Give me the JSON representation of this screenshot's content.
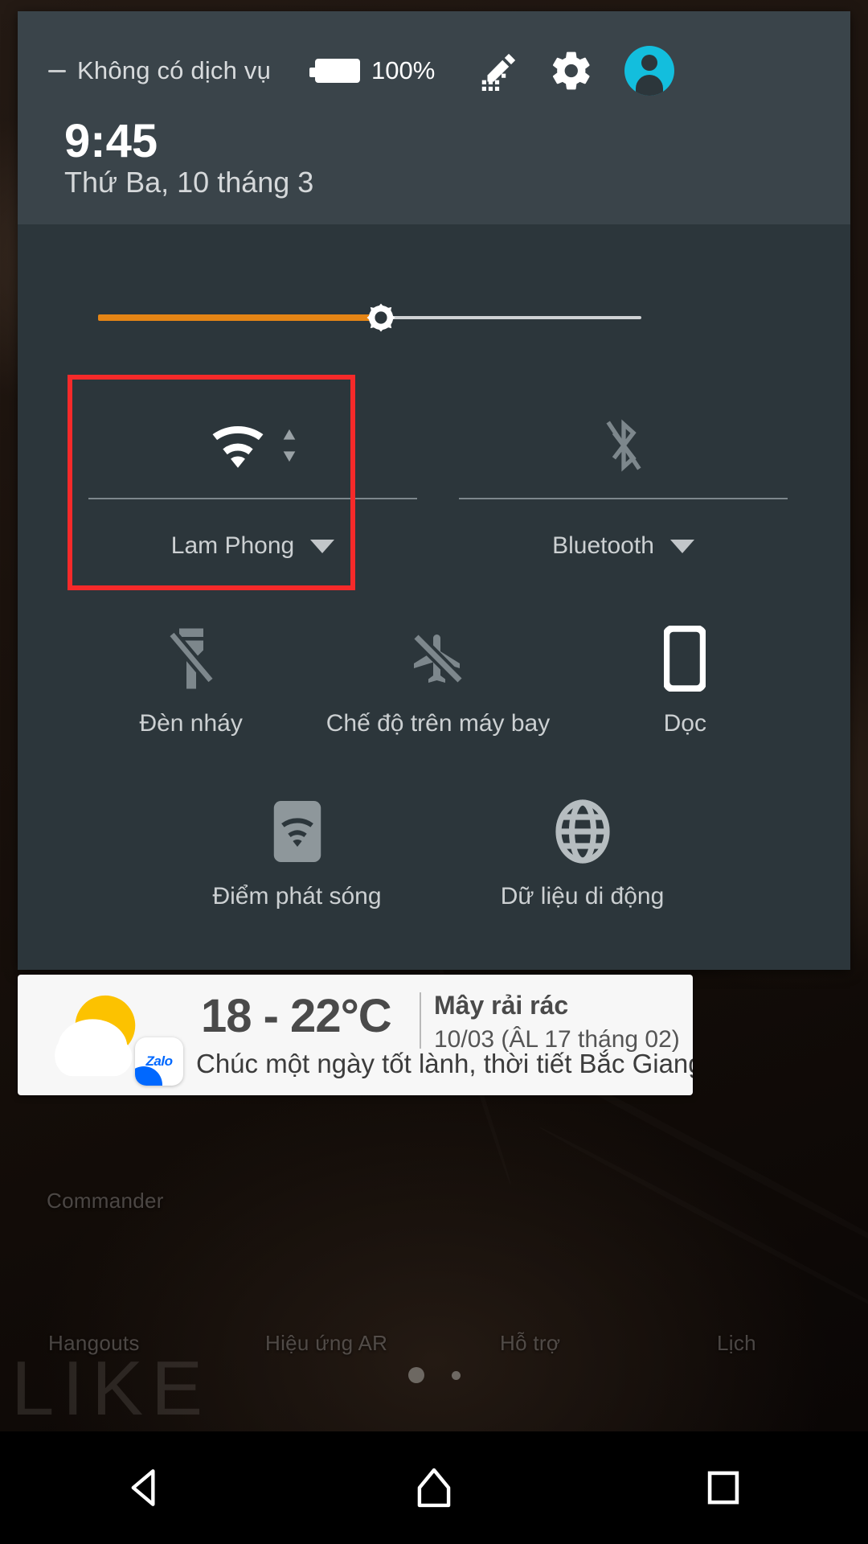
{
  "statusbar": {
    "carrier": "Không có dịch vụ",
    "battery_percent": "100%",
    "icons": {
      "dash": "no-signal-dash",
      "battery": "battery-full-icon",
      "edit": "edit-pencil-icon",
      "settings": "gear-icon",
      "avatar": "user-avatar-icon"
    }
  },
  "header": {
    "time": "9:45",
    "date": "Thứ Ba, 10 tháng 3"
  },
  "brightness": {
    "label": "brightness-slider",
    "value_percent": 52
  },
  "quick_settings": {
    "big_tiles": [
      {
        "id": "wifi",
        "label": "Lam Phong",
        "icon": "wifi-icon",
        "state": "on",
        "has_caret": true,
        "activity": "wifi-activity-arrows",
        "highlighted": true
      },
      {
        "id": "bluetooth",
        "label": "Bluetooth",
        "icon": "bluetooth-disabled-icon",
        "state": "off",
        "has_caret": true,
        "highlighted": false
      }
    ],
    "small_tiles_row2": [
      {
        "id": "flashlight",
        "label": "Đèn nháy",
        "icon": "flashlight-off-icon",
        "state": "off"
      },
      {
        "id": "airplane",
        "label": "Chế độ trên máy bay",
        "icon": "airplane-off-icon",
        "state": "off"
      },
      {
        "id": "rotation",
        "label": "Dọc",
        "icon": "screen-portrait-icon",
        "state": "on"
      }
    ],
    "small_tiles_row3": [
      {
        "id": "hotspot",
        "label": "Điểm phát sóng",
        "icon": "hotspot-icon",
        "state": "off"
      },
      {
        "id": "mobile-data",
        "label": "Dữ liệu di động",
        "icon": "globe-icon",
        "state": "off"
      }
    ]
  },
  "notification": {
    "app": "Zalo",
    "temperature": "18 - 22°C",
    "condition": "Mây rải rác",
    "date": "10/03 (ÂL 17 tháng 02)",
    "message": "Chúc một ngày tốt lành, thời tiết Bắc Giang…",
    "weather_icon": "sun-behind-cloud-icon",
    "badge_icon": "zalo-badge-icon"
  },
  "background": {
    "widget_text": "LIKE",
    "app_labels_top": [
      "Commander"
    ],
    "app_labels_bottom": [
      "Hangouts",
      "Hiệu ứng AR",
      "Hỗ trợ",
      "Lịch"
    ]
  },
  "page_dots": {
    "count": 2,
    "active_index": 0
  },
  "navbar": {
    "back": "back-icon",
    "home": "home-icon",
    "recents": "recents-icon"
  },
  "colors": {
    "panel_bg": "#2c363b",
    "header_bg": "#3a444a",
    "accent_orange": "#e58515",
    "highlight_red": "#f62a2a",
    "avatar_cyan": "#13bedd",
    "zalo_blue": "#0068ff"
  }
}
